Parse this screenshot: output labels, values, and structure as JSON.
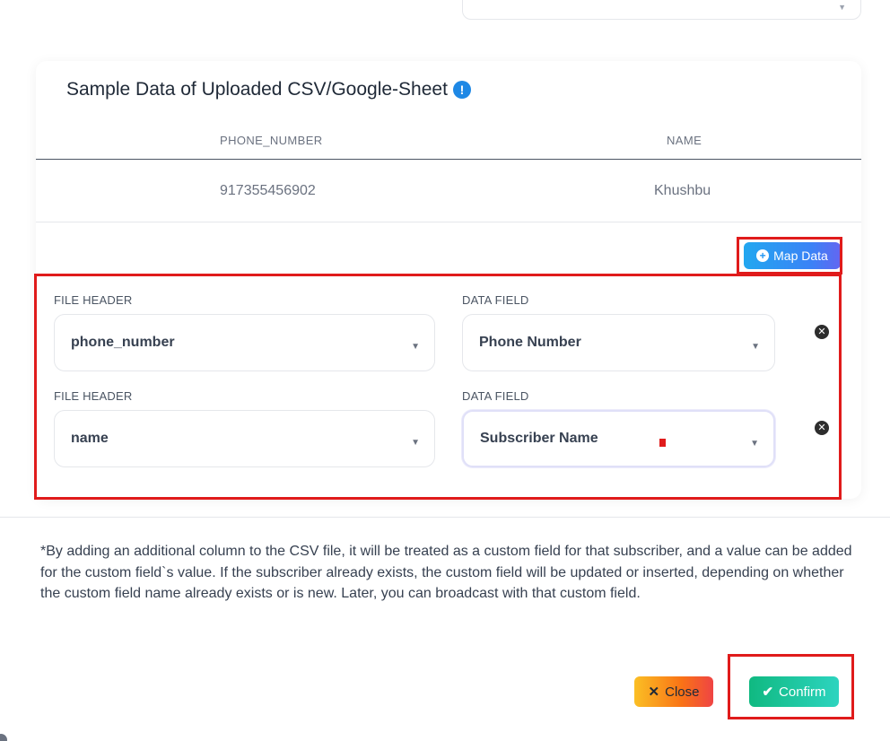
{
  "card": {
    "title": "Sample Data of Uploaded CSV/Google-Sheet",
    "info_icon": "!",
    "table": {
      "headers": [
        "PHONE_NUMBER",
        "NAME"
      ],
      "rows": [
        [
          "917355456902",
          "Khushbu"
        ]
      ]
    },
    "map_button_label": "Map Data"
  },
  "mapping": {
    "rows": [
      {
        "file_header_label": "FILE HEADER",
        "file_header_value": "phone_number",
        "data_field_label": "DATA FIELD",
        "data_field_value": "Phone Number"
      },
      {
        "file_header_label": "FILE HEADER",
        "file_header_value": "name",
        "data_field_label": "DATA FIELD",
        "data_field_value": "Subscriber Name"
      }
    ]
  },
  "note": "*By adding an additional column to the CSV file, it will be treated as a custom field for that subscriber, and a value can be added for the custom field`s value. If the subscriber already exists, the custom field will be updated or inserted, depending on whether the custom field name already exists or is new. Later, you can broadcast with that custom field.",
  "footer": {
    "close_label": "Close",
    "confirm_label": "Confirm"
  },
  "icons": {
    "close": "x-icon",
    "confirm": "check-icon",
    "remove": "remove-circle-icon",
    "map": "plus-circle-icon"
  },
  "colors": {
    "highlight": "#e01b1b",
    "map_button": "#3b82f6",
    "confirm": "#10b981",
    "close": "#f97316",
    "info": "#1e88e5"
  }
}
